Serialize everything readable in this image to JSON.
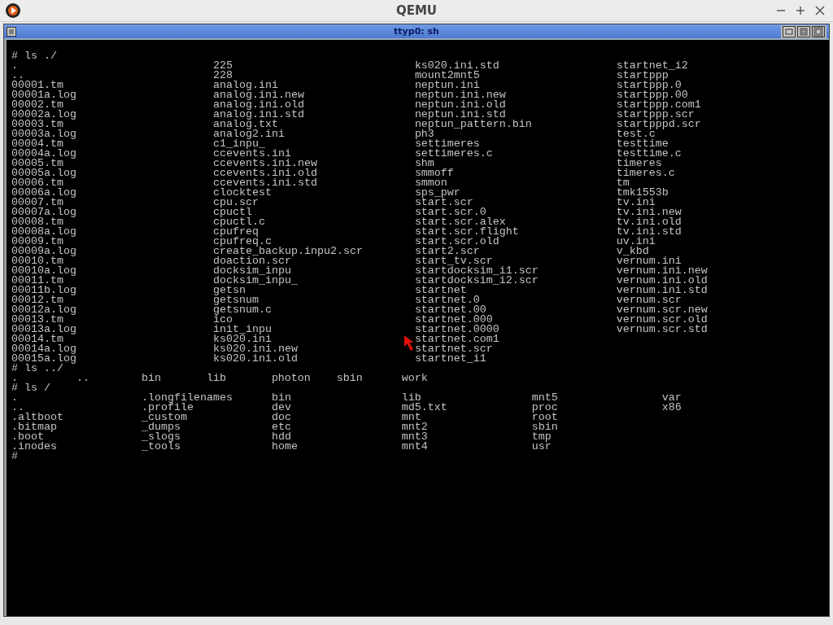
{
  "window": {
    "title": "QEMU"
  },
  "terminal_window": {
    "title": "ttyp0: sh"
  },
  "listings": [
    {
      "command": "# ls ./",
      "columns": [
        [
          ".",
          "..",
          "00001.tm",
          "00001a.log",
          "00002.tm",
          "00002a.log",
          "00003.tm",
          "00003a.log",
          "00004.tm",
          "00004a.log",
          "00005.tm",
          "00005a.log",
          "00006.tm",
          "00006a.log",
          "00007.tm",
          "00007a.log",
          "00008.tm",
          "00008a.log",
          "00009.tm",
          "00009a.log",
          "00010.tm",
          "00010a.log",
          "00011.tm",
          "00011b.log",
          "00012.tm",
          "00012a.log",
          "00013.tm",
          "00013a.log",
          "00014.tm",
          "00014a.log",
          "00015a.log"
        ],
        [
          "225",
          "228",
          "analog.ini",
          "analog.ini.new",
          "analog.ini.old",
          "analog.ini.std",
          "analog.txt",
          "analog2.ini",
          "c1_inpu_",
          "ccevents.ini",
          "ccevents.ini.new",
          "ccevents.ini.old",
          "ccevents.ini.std",
          "clocktest",
          "cpu.scr",
          "cpuctl",
          "cpuctl.c",
          "cpufreq",
          "cpufreq.c",
          "create_backup.inpu2.scr",
          "doaction.scr",
          "docksim_inpu",
          "docksim_inpu_",
          "getsn",
          "getsnum",
          "getsnum.c",
          "ico",
          "init_inpu",
          "ks020.ini",
          "ks020.ini.new",
          "ks020.ini.old"
        ],
        [
          "ks020.ini.std",
          "mount2mnt5",
          "neptun.ini",
          "neptun.ini.new",
          "neptun.ini.old",
          "neptun.ini.std",
          "neptun_pattern.bin",
          "ph3",
          "settimeres",
          "settimeres.c",
          "shm",
          "smmoff",
          "smmon",
          "sps_pwr",
          "start.scr",
          "start.scr.0",
          "start.scr.alex",
          "start.scr.flight",
          "start.scr.old",
          "start2.scr",
          "start_tv.scr",
          "startdocksim_i1.scr",
          "startdocksim_i2.scr",
          "startnet",
          "startnet.0",
          "startnet.00",
          "startnet.000",
          "startnet.0000",
          "startnet.com1",
          "startnet.scr",
          "startnet_i1"
        ],
        [
          "startnet_i2",
          "startppp",
          "startppp.0",
          "startppp.00",
          "startppp.com1",
          "startppp.scr",
          "startpppd.scr",
          "test.c",
          "testtime",
          "testtime.c",
          "timeres",
          "timeres.c",
          "tm",
          "tmk1553b",
          "tv.ini",
          "tv.ini.new",
          "tv.ini.old",
          "tv.ini.std",
          "uv.ini",
          "v_kbd",
          "vernum.ini",
          "vernum.ini.new",
          "vernum.ini.old",
          "vernum.ini.std",
          "vernum.scr",
          "vernum.scr.new",
          "vernum.scr.old",
          "vernum.scr.std"
        ]
      ]
    },
    {
      "command": "# ls ../",
      "columns": [
        [
          "."
        ],
        [
          ".."
        ],
        [
          "bin"
        ],
        [
          "lib"
        ],
        [
          "photon"
        ],
        [
          "sbin"
        ],
        [
          "work"
        ]
      ]
    },
    {
      "command": "# ls /",
      "columns": [
        [
          ".",
          "..",
          ".altboot",
          ".bitmap",
          ".boot",
          ".inodes"
        ],
        [
          ".longfilenames",
          ".profile",
          "_custom",
          "_dumps",
          "_slogs",
          "_tools"
        ],
        [
          "bin",
          "dev",
          "doc",
          "etc",
          "hdd",
          "home"
        ],
        [
          "lib",
          "md5.txt",
          "mnt",
          "mnt2",
          "mnt3",
          "mnt4"
        ],
        [
          "mnt5",
          "proc",
          "root",
          "sbin",
          "tmp",
          "usr"
        ],
        [
          "var",
          "x86"
        ]
      ]
    }
  ],
  "prompt": "#"
}
